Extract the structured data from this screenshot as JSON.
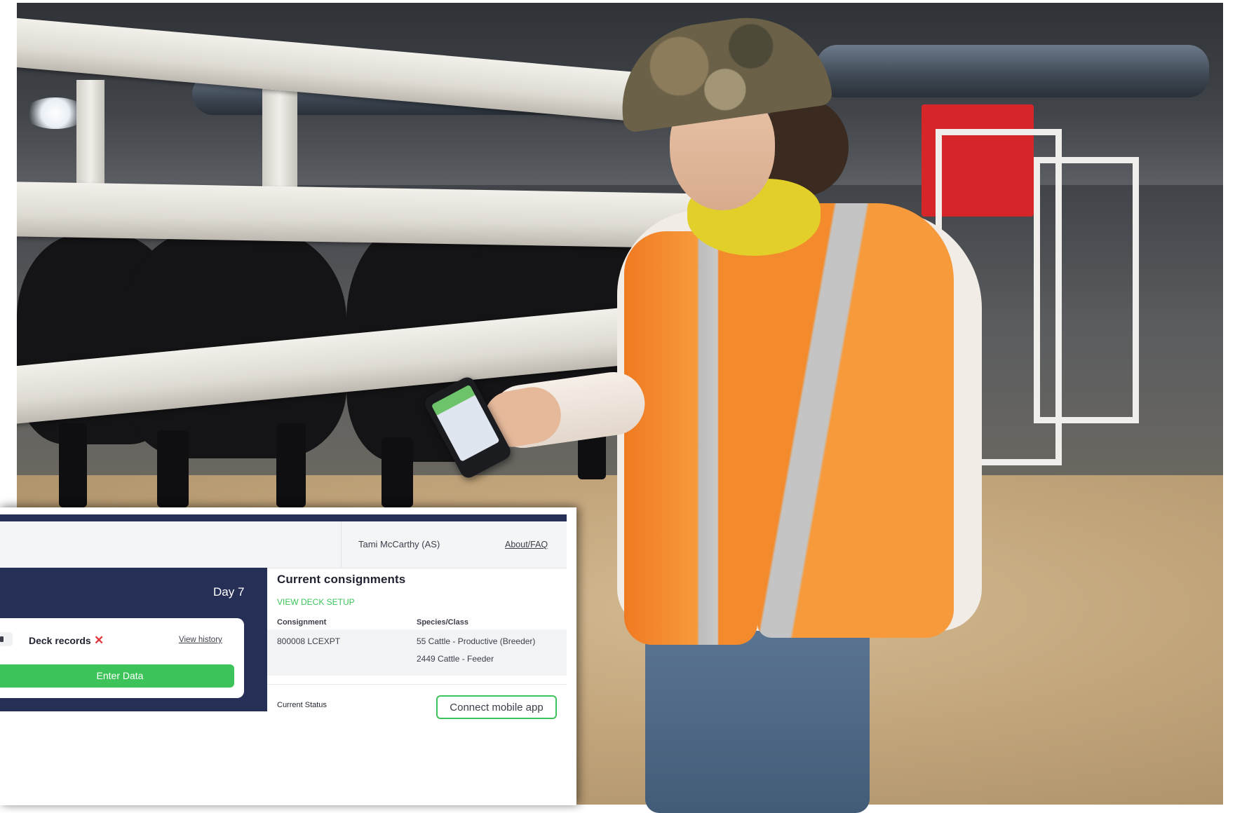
{
  "header": {
    "user": "Tami McCarthy (AS)",
    "about_link": "About/FAQ"
  },
  "summary_card": {
    "day": "Day 7",
    "deck_records_label": "Deck records",
    "deck_records_status_icon": "close-icon",
    "view_history": "View history",
    "enter_data": "Enter Data"
  },
  "consignments": {
    "title": "Current consignments",
    "view_deck_setup": "VIEW DECK SETUP",
    "columns": [
      "Consignment",
      "Species/Class"
    ],
    "rows": [
      {
        "consignment": "800008 LCEXPT",
        "classes": [
          "55 Cattle - Productive (Breeder)",
          "2449 Cattle - Feeder"
        ]
      }
    ]
  },
  "status": {
    "label": "Current Status",
    "connect_button": "Connect mobile app"
  },
  "colors": {
    "navy": "#263056",
    "green": "#3cc35a",
    "alert_red": "#e0363b"
  }
}
